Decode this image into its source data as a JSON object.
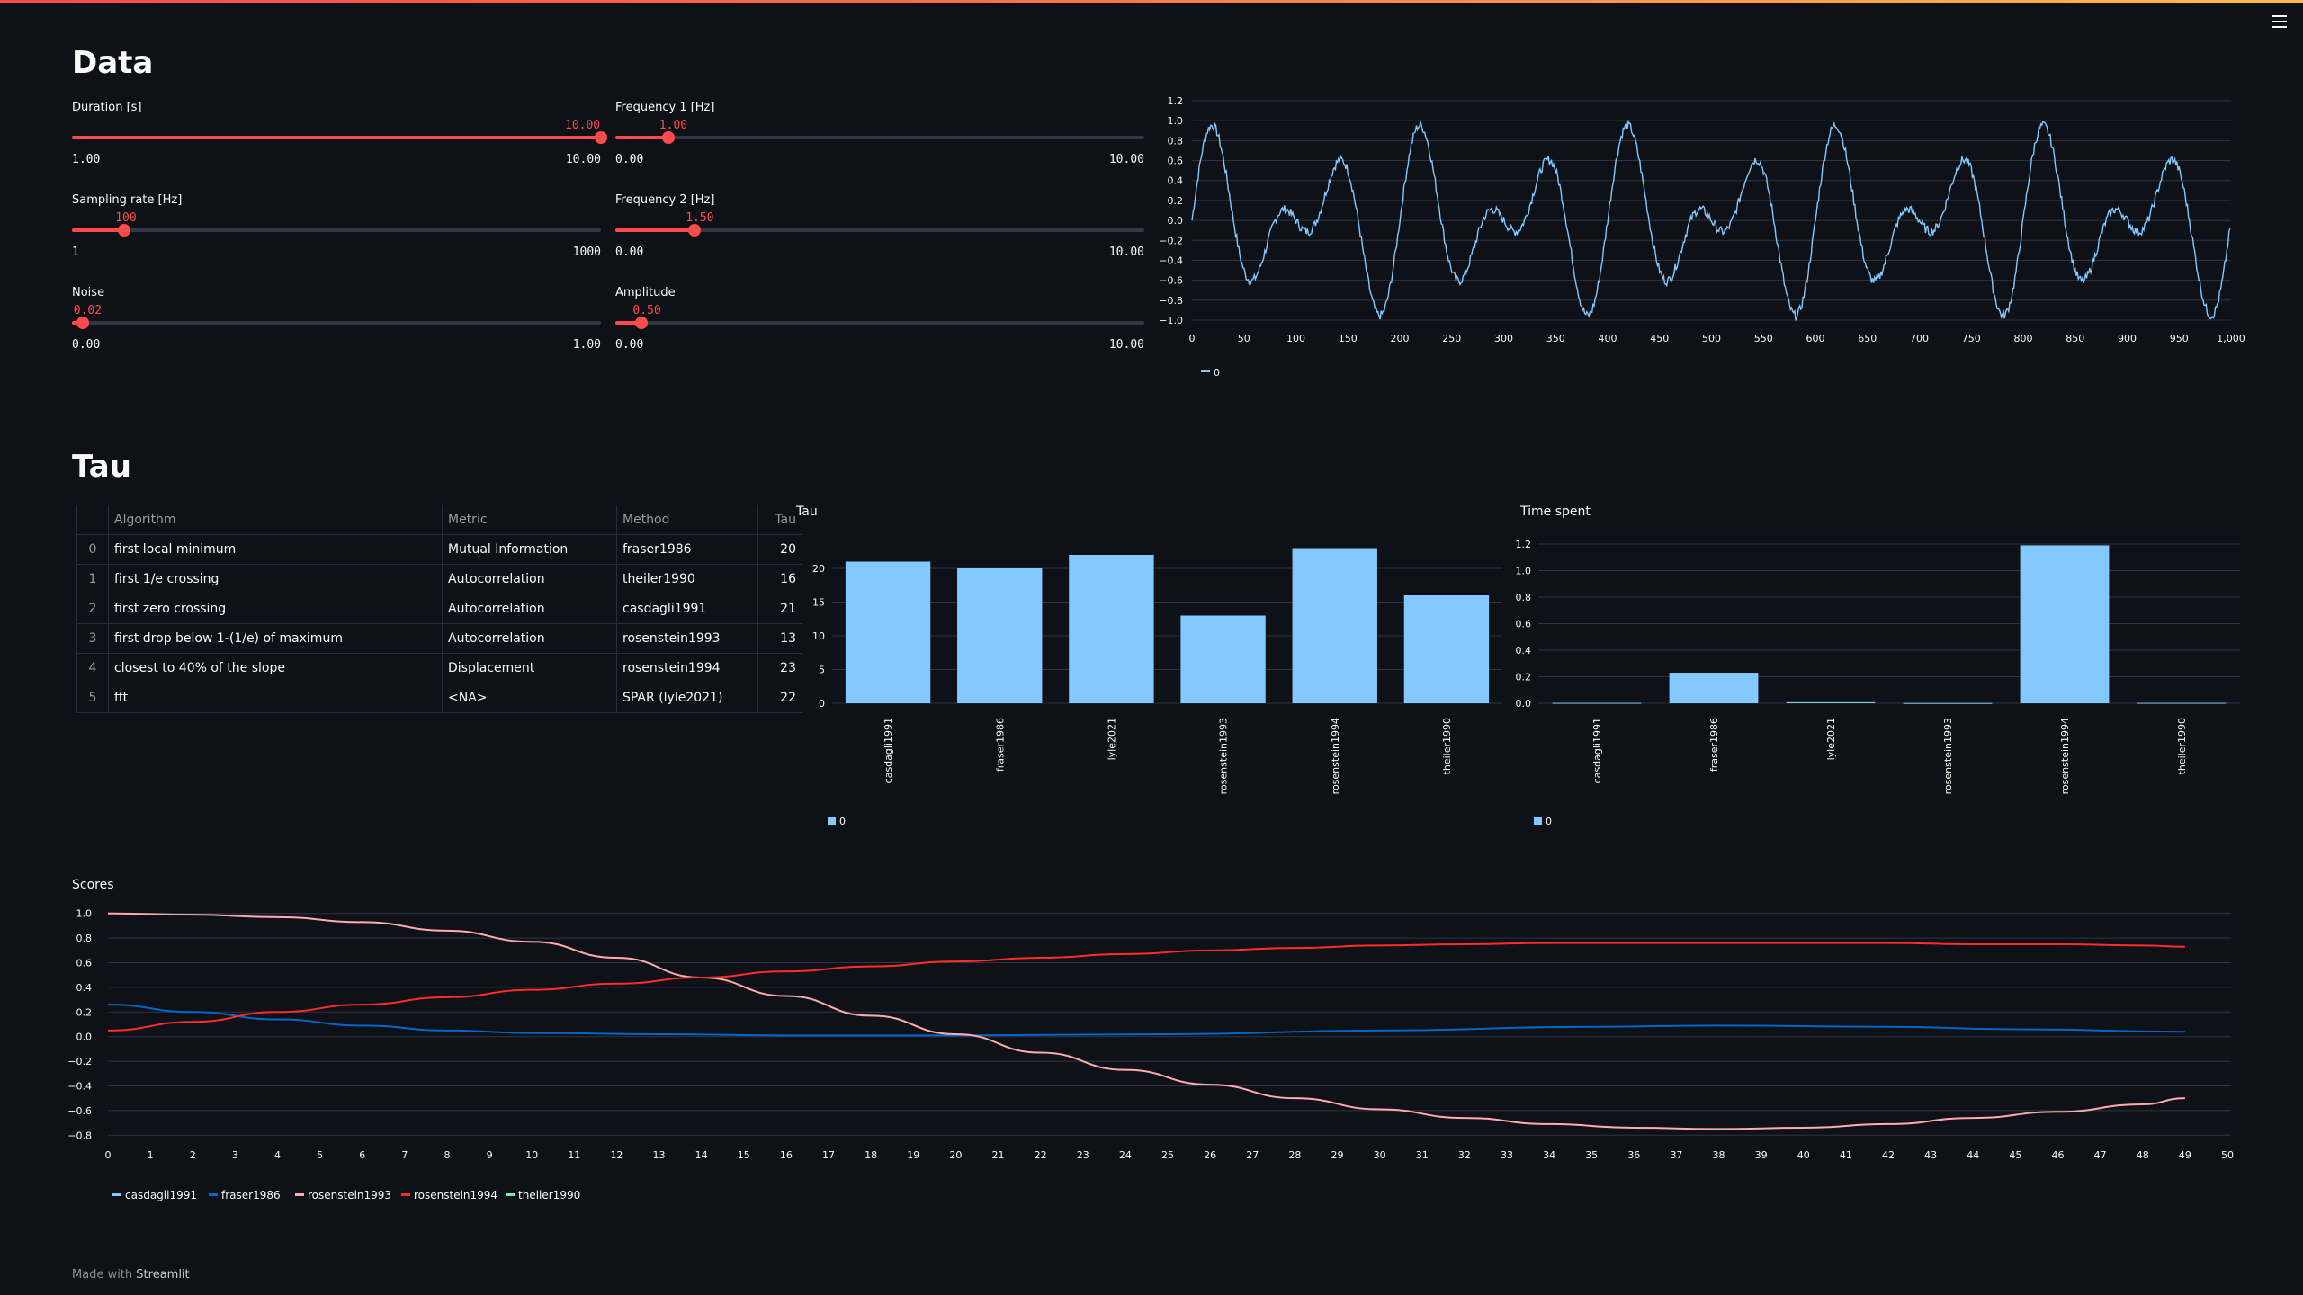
{
  "header": {
    "menu_icon": "hamburger-menu-icon"
  },
  "data_section": {
    "title": "Data",
    "sliders": [
      {
        "id": "duration",
        "label": "Duration [s]",
        "value": "10.00",
        "min": "1.00",
        "max": "10.00",
        "fraction": 1.0
      },
      {
        "id": "freq1",
        "label": "Frequency 1 [Hz]",
        "value": "1.00",
        "min": "0.00",
        "max": "10.00",
        "fraction": 0.1
      },
      {
        "id": "sampling",
        "label": "Sampling rate [Hz]",
        "value": "100",
        "min": "1",
        "max": "1000",
        "fraction": 0.099
      },
      {
        "id": "freq2",
        "label": "Frequency 2 [Hz]",
        "value": "1.50",
        "min": "0.00",
        "max": "10.00",
        "fraction": 0.15
      },
      {
        "id": "noise",
        "label": "Noise",
        "value": "0.02",
        "min": "0.00",
        "max": "1.00",
        "fraction": 0.02
      },
      {
        "id": "amplitude",
        "label": "Amplitude",
        "value": "0.50",
        "min": "0.00",
        "max": "10.00",
        "fraction": 0.05
      }
    ]
  },
  "tau_section": {
    "title": "Tau",
    "table": {
      "columns": [
        "",
        "Algorithm",
        "Metric",
        "Method",
        "Tau"
      ],
      "rows": [
        [
          "0",
          "first local minimum",
          "Mutual Information",
          "fraser1986",
          "20"
        ],
        [
          "1",
          "first 1/e crossing",
          "Autocorrelation",
          "theiler1990",
          "16"
        ],
        [
          "2",
          "first zero crossing",
          "Autocorrelation",
          "casdagli1991",
          "21"
        ],
        [
          "3",
          "first drop below 1-(1/e) of maximum",
          "Autocorrelation",
          "rosenstein1993",
          "13"
        ],
        [
          "4",
          "closest to 40% of the slope",
          "Displacement",
          "rosenstein1994",
          "23"
        ],
        [
          "5",
          "fft",
          "<NA>",
          "SPAR (lyle2021)",
          "22"
        ]
      ]
    }
  },
  "footer": {
    "prefix": "Made with ",
    "brand": "Streamlit"
  },
  "colors": {
    "accent": "#ff4b4b",
    "line": "#83c9ff",
    "bar": "#83c9ff",
    "background": "#0e1117"
  },
  "chart_data": [
    {
      "id": "signal",
      "type": "line",
      "title": "",
      "x_range": [
        0,
        1000
      ],
      "ylim": [
        -1.0,
        1.2
      ],
      "x_ticks": [
        0,
        50,
        100,
        150,
        200,
        250,
        300,
        350,
        400,
        450,
        500,
        550,
        600,
        650,
        700,
        750,
        800,
        850,
        900,
        950,
        1000
      ],
      "x_tick_labels": [
        "0",
        "50",
        "100",
        "150",
        "200",
        "250",
        "300",
        "350",
        "400",
        "450",
        "500",
        "550",
        "600",
        "650",
        "700",
        "750",
        "800",
        "850",
        "900",
        "950",
        "1,000"
      ],
      "y_ticks": [
        -1.0,
        -0.8,
        -0.6,
        -0.4,
        -0.2,
        0.0,
        0.2,
        0.4,
        0.6,
        0.8,
        1.0,
        1.2
      ],
      "y_tick_labels": [
        "−1.0",
        "−0.8",
        "−0.6",
        "−0.4",
        "−0.2",
        "0.0",
        "0.2",
        "0.4",
        "0.6",
        "0.8",
        "1.0",
        "1.2"
      ],
      "series": [
        {
          "name": "0",
          "formula": "0.5*sin(2*pi*1*t)+0.5*sin(2*pi*1.5*t)+noise(0.02)",
          "sampling_rate_hz": 100,
          "n_points": 1000
        }
      ],
      "legend": "bottom-left",
      "grid": true
    },
    {
      "id": "tau",
      "type": "bar",
      "title": "Tau",
      "categories": [
        "casdagli1991",
        "fraser1986",
        "lyle2021",
        "rosenstein1993",
        "rosenstein1994",
        "theiler1990"
      ],
      "series": [
        {
          "name": "0",
          "values": [
            21,
            20,
            22,
            13,
            23,
            16
          ]
        }
      ],
      "ylim": [
        0,
        24
      ],
      "y_ticks": [
        0,
        5,
        10,
        15,
        20
      ],
      "y_tick_labels": [
        "0",
        "5",
        "10",
        "15",
        "20"
      ],
      "legend": "bottom-left",
      "grid": true
    },
    {
      "id": "time",
      "type": "bar",
      "title": "Time spent",
      "categories": [
        "casdagli1991",
        "fraser1986",
        "lyle2021",
        "rosenstein1993",
        "rosenstein1994",
        "theiler1990"
      ],
      "series": [
        {
          "name": "0",
          "values": [
            0.003,
            0.23,
            0.008,
            0.002,
            1.19,
            0.003
          ]
        }
      ],
      "ylim": [
        0,
        1.22
      ],
      "y_ticks": [
        0,
        0.2,
        0.4,
        0.6,
        0.8,
        1.0,
        1.2
      ],
      "y_tick_labels": [
        "0.0",
        "0.2",
        "0.4",
        "0.6",
        "0.8",
        "1.0",
        "1.2"
      ],
      "legend": "bottom-left",
      "grid": true
    },
    {
      "id": "scores",
      "type": "line",
      "title": "Scores",
      "x_range": [
        0,
        50
      ],
      "ylim": [
        -0.82,
        1.02
      ],
      "x_ticks": [
        0,
        1,
        2,
        3,
        4,
        5,
        6,
        7,
        8,
        9,
        10,
        11,
        12,
        13,
        14,
        15,
        16,
        17,
        18,
        19,
        20,
        21,
        22,
        23,
        24,
        25,
        26,
        27,
        28,
        29,
        30,
        31,
        32,
        33,
        34,
        35,
        36,
        37,
        38,
        39,
        40,
        41,
        42,
        43,
        44,
        45,
        46,
        47,
        48,
        49,
        50
      ],
      "y_ticks": [
        -0.8,
        -0.6,
        -0.4,
        -0.2,
        0.0,
        0.2,
        0.4,
        0.6,
        0.8,
        1.0
      ],
      "y_tick_labels": [
        "−0.8",
        "−0.6",
        "−0.4",
        "−0.2",
        "0.0",
        "0.2",
        "0.4",
        "0.6",
        "0.8",
        "1.0"
      ],
      "series": [
        {
          "name": "casdagli1991",
          "color": "#83c9ff",
          "points": []
        },
        {
          "name": "fraser1986",
          "color": "#0068c9",
          "points": [
            [
              0,
              0.26
            ],
            [
              2,
              0.2
            ],
            [
              4,
              0.14
            ],
            [
              6,
              0.09
            ],
            [
              8,
              0.05
            ],
            [
              10,
              0.03
            ],
            [
              13,
              0.02
            ],
            [
              16,
              0.01
            ],
            [
              20,
              0.01
            ],
            [
              25,
              0.02
            ],
            [
              30,
              0.05
            ],
            [
              35,
              0.08
            ],
            [
              38,
              0.09
            ],
            [
              42,
              0.08
            ],
            [
              45,
              0.06
            ],
            [
              49,
              0.04
            ]
          ]
        },
        {
          "name": "rosenstein1993",
          "color": "#ffabab",
          "points": [
            [
              0,
              1.0
            ],
            [
              2,
              0.99
            ],
            [
              4,
              0.97
            ],
            [
              6,
              0.93
            ],
            [
              8,
              0.86
            ],
            [
              10,
              0.77
            ],
            [
              12,
              0.64
            ],
            [
              14,
              0.48
            ],
            [
              16,
              0.33
            ],
            [
              18,
              0.17
            ],
            [
              20,
              0.02
            ],
            [
              22,
              -0.13
            ],
            [
              24,
              -0.27
            ],
            [
              26,
              -0.39
            ],
            [
              28,
              -0.5
            ],
            [
              30,
              -0.59
            ],
            [
              32,
              -0.66
            ],
            [
              34,
              -0.71
            ],
            [
              36,
              -0.74
            ],
            [
              38,
              -0.75
            ],
            [
              40,
              -0.74
            ],
            [
              42,
              -0.71
            ],
            [
              44,
              -0.66
            ],
            [
              46,
              -0.61
            ],
            [
              48,
              -0.55
            ],
            [
              49,
              -0.5
            ]
          ]
        },
        {
          "name": "rosenstein1994",
          "color": "#ff2b2b",
          "points": [
            [
              0,
              0.05
            ],
            [
              2,
              0.12
            ],
            [
              4,
              0.2
            ],
            [
              6,
              0.26
            ],
            [
              8,
              0.32
            ],
            [
              10,
              0.38
            ],
            [
              12,
              0.43
            ],
            [
              14,
              0.48
            ],
            [
              16,
              0.53
            ],
            [
              18,
              0.57
            ],
            [
              20,
              0.61
            ],
            [
              22,
              0.64
            ],
            [
              24,
              0.67
            ],
            [
              26,
              0.7
            ],
            [
              28,
              0.72
            ],
            [
              30,
              0.74
            ],
            [
              32,
              0.75
            ],
            [
              34,
              0.76
            ],
            [
              36,
              0.76
            ],
            [
              38,
              0.76
            ],
            [
              40,
              0.76
            ],
            [
              42,
              0.76
            ],
            [
              44,
              0.75
            ],
            [
              46,
              0.75
            ],
            [
              48,
              0.74
            ],
            [
              49,
              0.73
            ]
          ]
        },
        {
          "name": "theiler1990",
          "color": "#7defa1",
          "points": []
        }
      ],
      "legend": "bottom-left",
      "grid": true
    }
  ]
}
